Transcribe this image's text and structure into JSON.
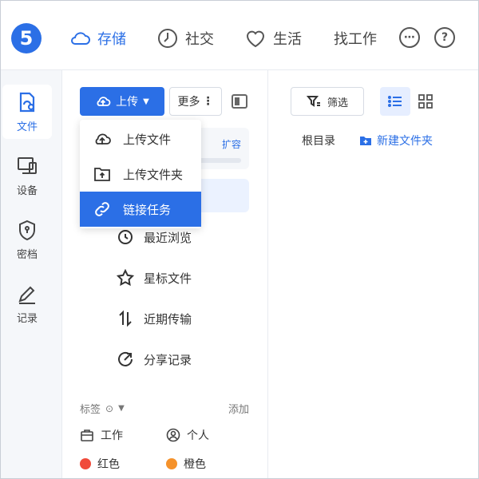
{
  "brand": {
    "logo_text": "5",
    "accent": "#2b6fe6"
  },
  "topnav": {
    "items": [
      {
        "label": "存储",
        "icon": "cloud-icon",
        "active": true
      },
      {
        "label": "社交",
        "icon": "clock-icon",
        "active": false
      },
      {
        "label": "生活",
        "icon": "heart-icon",
        "active": false
      },
      {
        "label": "找工作",
        "icon": "",
        "active": false
      }
    ],
    "more_icon": "more-dots-icon",
    "help_icon": "help-icon",
    "help_text": "?"
  },
  "rail": {
    "items": [
      {
        "label": "文件",
        "icon": "file-icon",
        "active": true
      },
      {
        "label": "设备",
        "icon": "device-icon",
        "active": false
      },
      {
        "label": "密档",
        "icon": "shield-icon",
        "active": false
      },
      {
        "label": "记录",
        "icon": "pen-icon",
        "active": false
      }
    ]
  },
  "toolbar": {
    "upload_label": "上传",
    "more_label": "更多"
  },
  "expand_link": "扩容",
  "sidebar": {
    "items": [
      {
        "label": "最近浏览",
        "icon": "history-icon"
      },
      {
        "label": "星标文件",
        "icon": "star-icon"
      },
      {
        "label": "近期传输",
        "icon": "transfer-icon"
      },
      {
        "label": "分享记录",
        "icon": "share-icon"
      }
    ]
  },
  "tags": {
    "title": "标签",
    "add_label": "添加",
    "items": [
      {
        "label": "工作",
        "icon": "briefcase-icon"
      },
      {
        "label": "个人",
        "icon": "person-icon"
      },
      {
        "label": "红色",
        "color": "#f04a3a"
      },
      {
        "label": "橙色",
        "color": "#f5922b"
      }
    ]
  },
  "main": {
    "filter_label": "筛选",
    "breadcrumb": "根目录",
    "new_folder_label": "新建文件夹"
  },
  "upload_menu": {
    "items": [
      {
        "label": "上传文件",
        "icon": "upload-cloud-icon",
        "active": false
      },
      {
        "label": "上传文件夹",
        "icon": "upload-folder-icon",
        "active": false
      },
      {
        "label": "链接任务",
        "icon": "link-icon",
        "active": true
      }
    ]
  }
}
